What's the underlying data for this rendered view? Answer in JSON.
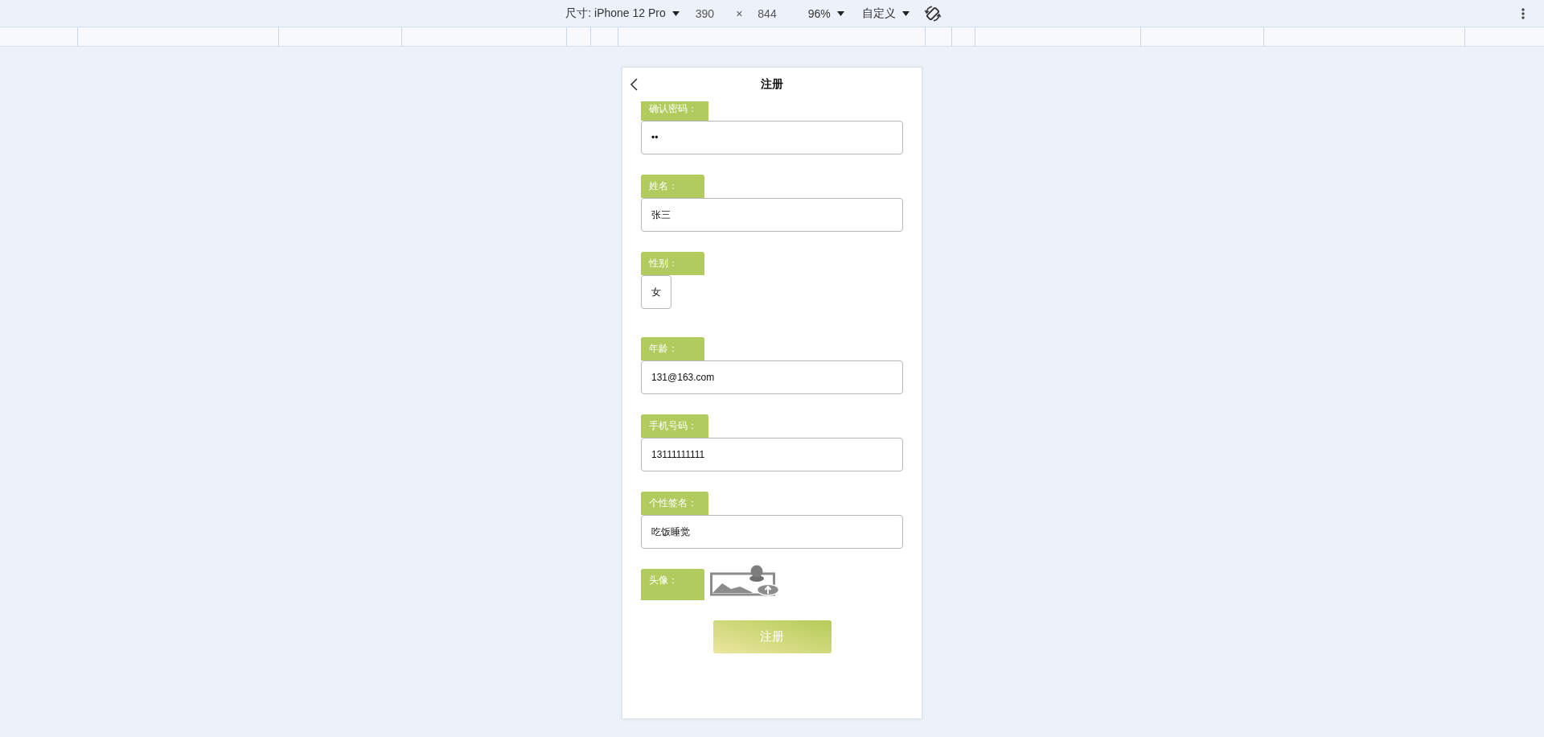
{
  "toolbar": {
    "device_select": {
      "label": "尺寸: iPhone 12 Pro"
    },
    "width_field": {
      "value": "390"
    },
    "dimension_separator": "×",
    "height_field": {
      "value": "844"
    },
    "zoom_select": {
      "label": "96%"
    },
    "throttle_select": {
      "label": "自定义"
    }
  },
  "page": {
    "title": "注册",
    "fields": [
      {
        "kind": "text",
        "label": "确认密码：",
        "value": "••"
      },
      {
        "kind": "text",
        "label": "姓名：",
        "value": "张三"
      },
      {
        "kind": "picker",
        "label": "性别：",
        "value": "女"
      },
      {
        "kind": "text",
        "label": "年龄：",
        "value": "131@163.com"
      },
      {
        "kind": "text",
        "label": "手机号码：",
        "value": "13111111111"
      },
      {
        "kind": "text",
        "label": "个性签名：",
        "value": "吃饭睡觉"
      },
      {
        "kind": "image",
        "label": "头像："
      }
    ],
    "submit_button": "注册"
  }
}
